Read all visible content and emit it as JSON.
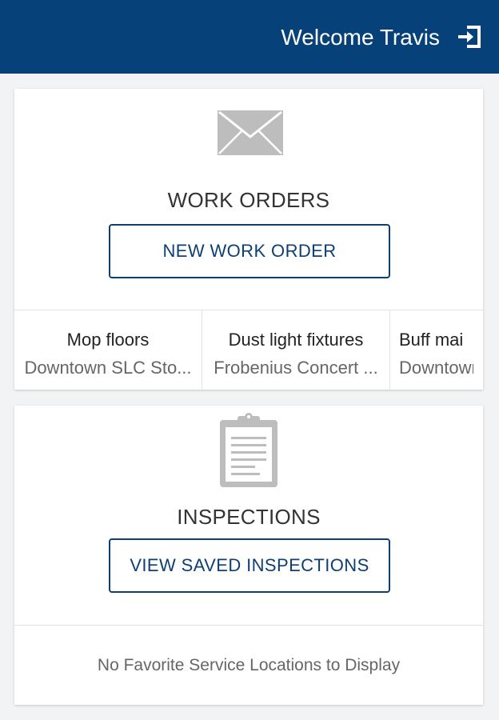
{
  "header": {
    "welcome": "Welcome Travis",
    "logout_icon": "logout-icon",
    "background": "#06417a"
  },
  "work_orders": {
    "icon": "envelope-icon",
    "title": "WORK ORDERS",
    "new_button": "NEW WORK ORDER",
    "items": [
      {
        "title": "Mop floors",
        "location": "Downtown SLC Sto..."
      },
      {
        "title": "Dust light fixtures",
        "location": "Frobenius Concert ..."
      },
      {
        "title": "Buff mai",
        "location": "Downtown"
      }
    ]
  },
  "inspections": {
    "icon": "clipboard-icon",
    "title": "INSPECTIONS",
    "view_button": "VIEW SAVED INSPECTIONS",
    "empty_favorites": "No Favorite Service Locations to Display"
  },
  "colors": {
    "accent": "#0d3f74",
    "icon_gray": "#bdbdbd"
  }
}
